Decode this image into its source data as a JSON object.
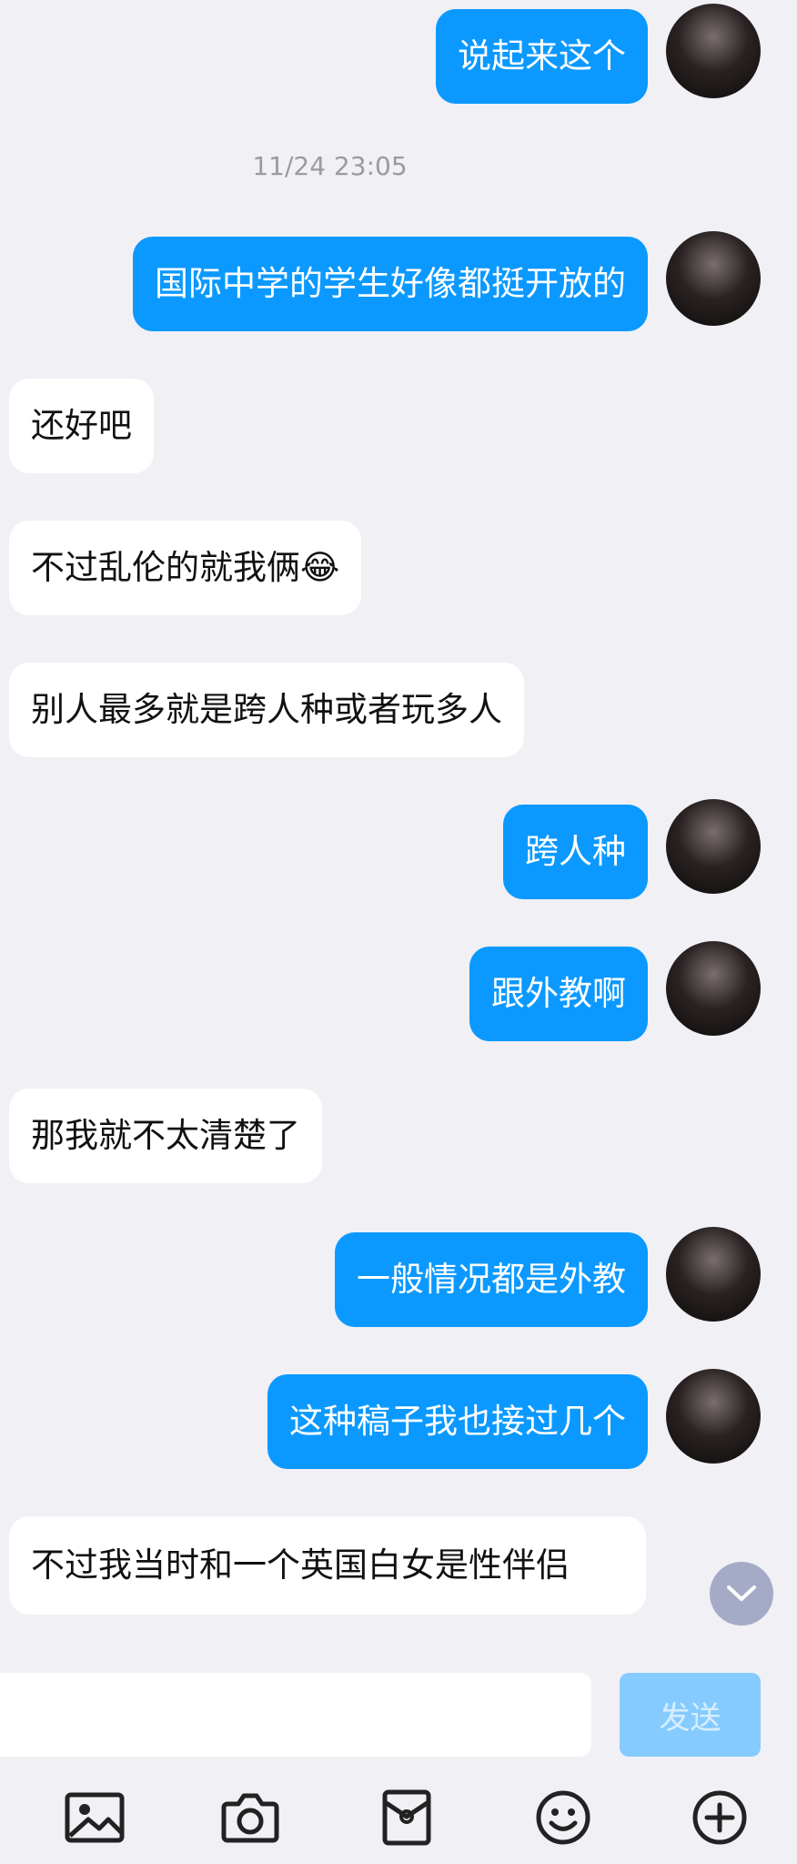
{
  "messages": [
    {
      "side": "out",
      "text": "说起来这个"
    },
    {
      "side": "time",
      "text": "11/24 23:05"
    },
    {
      "side": "out",
      "text": "国际中学的学生好像都挺开放的"
    },
    {
      "side": "in",
      "text": "还好吧"
    },
    {
      "side": "in",
      "text": "不过乱伦的就我俩😂"
    },
    {
      "side": "in",
      "text": "别人最多就是跨人种或者玩多人"
    },
    {
      "side": "out",
      "text": "跨人种"
    },
    {
      "side": "out",
      "text": "跟外教啊"
    },
    {
      "side": "in",
      "text": "那我就不太清楚了"
    },
    {
      "side": "out",
      "text": "一般情况都是外教"
    },
    {
      "side": "out",
      "text": "这种稿子我也接过几个"
    },
    {
      "side": "in",
      "text": "不过我当时和一个英国白女是性伴侣"
    }
  ],
  "composer": {
    "input_value": "",
    "send_label": "发送"
  },
  "toolbar": {
    "icons": [
      "image-icon",
      "camera-icon",
      "red-packet-icon",
      "emoji-icon",
      "plus-icon"
    ]
  },
  "colors": {
    "outgoing": "#0b99ff",
    "incoming": "#ffffff",
    "background": "#f0f0f5"
  }
}
